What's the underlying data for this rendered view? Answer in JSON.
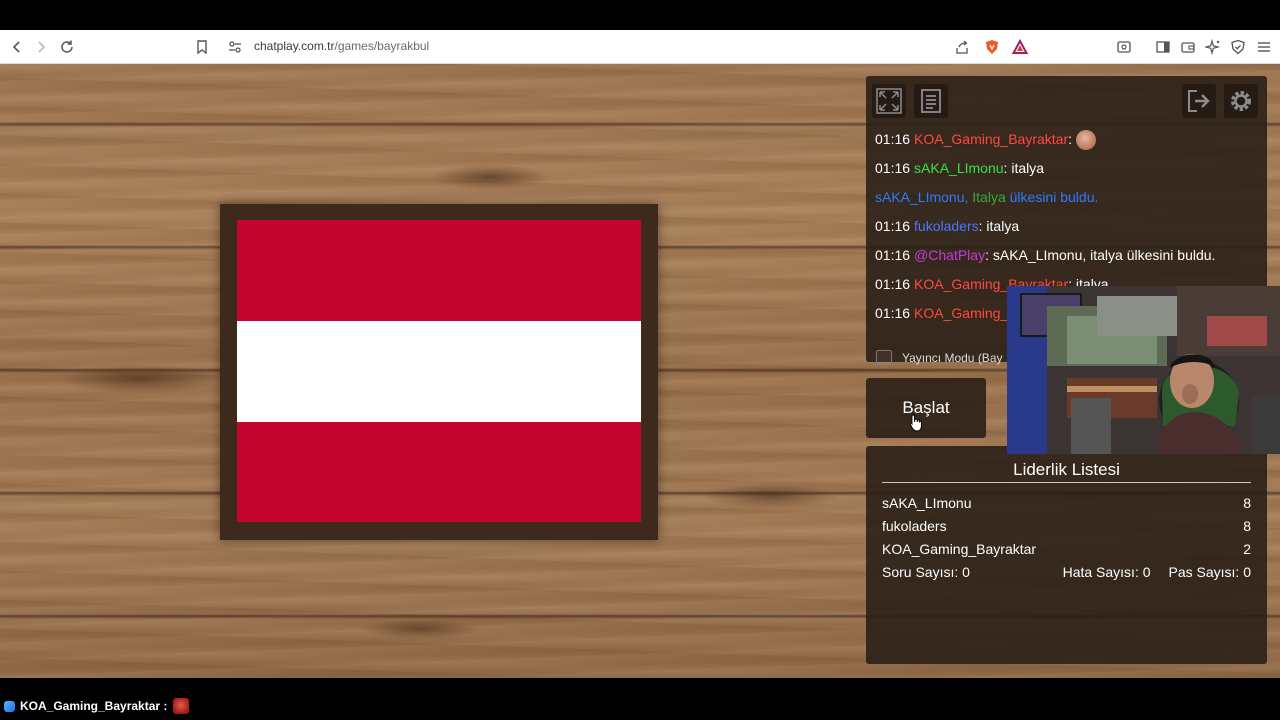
{
  "browser": {
    "url_domain": "chatplay.com.tr",
    "url_path": "/games/bayrakbul",
    "brave_badge": "1"
  },
  "colors": {
    "flag_red": "#c4062f",
    "flag_white": "#ffffff",
    "panel_bg": "#281e16",
    "wood": "#9c7450"
  },
  "chat": {
    "messages": [
      {
        "time": "01:16",
        "user": "KOA_Gaming_Bayraktar",
        "separator": ":",
        "text": "",
        "emote": "face-emote",
        "user_color": "#ff4a3d"
      },
      {
        "time": "01:16",
        "user": "sAKA_LImonu",
        "separator": ":",
        "text": "italya",
        "user_color": "#36e04a"
      },
      {
        "time": "",
        "user": "sAKA_LImonu,",
        "country": "Italya",
        "text": "ülkesini buldu.",
        "user_color": "#2e7bff"
      },
      {
        "time": "01:16",
        "user": "fukoladers",
        "separator": ":",
        "text": "italya",
        "user_color": "#4a78ff"
      },
      {
        "time": "01:16",
        "user": "@ChatPlay",
        "separator": ":",
        "text": "sAKA_LImonu, italya ülkesini buldu.",
        "user_color": "#c23bdc"
      },
      {
        "time": "01:16",
        "user": "KOA_Gaming_Bayraktar",
        "separator": ":",
        "text": "italya",
        "user_color": "#ff4a3d"
      },
      {
        "time": "01:16",
        "user": "KOA_Gaming_B",
        "separator": "",
        "text": "",
        "user_color": "#ff4a3d"
      }
    ],
    "streamer_mode_label": "Yayıncı Modu (Bay"
  },
  "start_button_label": "Başlat",
  "leaderboard": {
    "title": "Liderlik Listesi",
    "rows": [
      {
        "name": "sAKA_LImonu",
        "score": "8"
      },
      {
        "name": "fukoladers",
        "score": "8"
      },
      {
        "name": "KOA_Gaming_Bayraktar",
        "score": "2"
      }
    ],
    "question_count": "Soru Sayısı: 0",
    "error_count": "Hata Sayısı: 0",
    "pass_count": "Pas Sayısı: 0"
  },
  "bottom_chat": {
    "user": "KOA_Gaming_Bayraktar :"
  }
}
